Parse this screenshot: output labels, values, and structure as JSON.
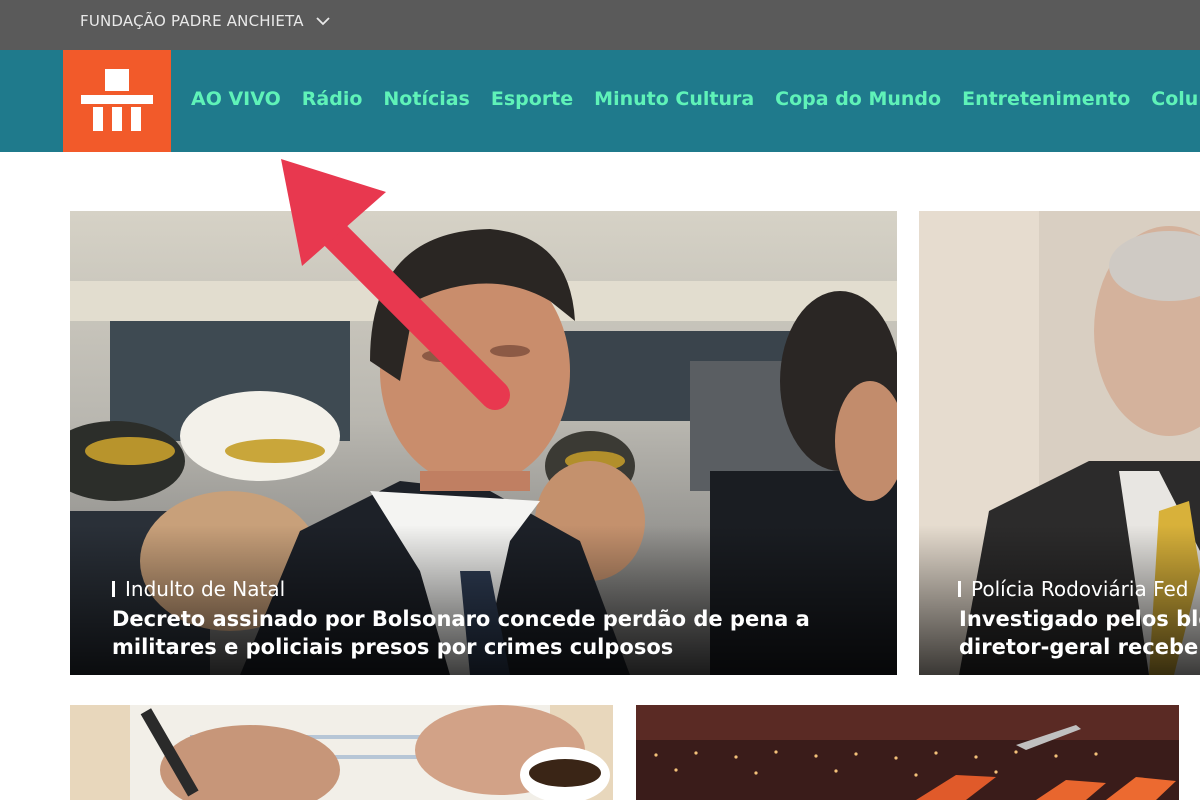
{
  "top_bar": {
    "foundation_label": "FUNDAÇÃO PADRE ANCHIETA",
    "dropdown_icon": "chevron-down-icon"
  },
  "navbar": {
    "logo_icon": "tv-cultura-logo",
    "items": [
      {
        "label": "AO VIVO"
      },
      {
        "label": "Rádio"
      },
      {
        "label": "Notícias"
      },
      {
        "label": "Esporte"
      },
      {
        "label": "Minuto Cultura"
      },
      {
        "label": "Copa do Mundo"
      },
      {
        "label": "Entretenimento"
      },
      {
        "label": "Colunas"
      }
    ]
  },
  "cards": {
    "main": {
      "kicker": "Indulto de Natal",
      "headline_line1": "Decreto assinado por Bolsonaro concede perdão de pena a",
      "headline_line2": "militares e policiais presos por crimes culposos"
    },
    "side": {
      "kicker": "Polícia Rodoviária Fed",
      "headline_line1": "Investigado pelos blo",
      "headline_line2": "diretor-geral recebe a"
    }
  },
  "colors": {
    "topbar": "#5a5a5a",
    "navbar": "#1f7a8c",
    "logo": "#f25a2a",
    "menu_text": "#5ff2b8",
    "annotation_arrow": "#e8384f"
  }
}
